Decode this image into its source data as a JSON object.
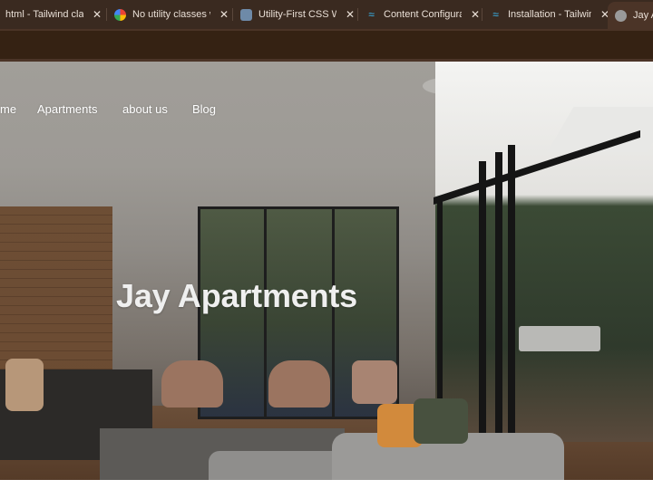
{
  "browser": {
    "tabs": [
      {
        "label": "html - Tailwind class",
        "icon": "stackoverflow-icon",
        "active": false
      },
      {
        "label": "No utility classes we",
        "icon": "google-icon",
        "active": false
      },
      {
        "label": "Utility-First CSS With",
        "icon": "cube-icon",
        "active": false
      },
      {
        "label": "Content Configuratio",
        "icon": "tailwind-icon",
        "active": false
      },
      {
        "label": "Installation - Tailwind",
        "icon": "tailwind-icon",
        "active": false
      },
      {
        "label": "Jay Ap",
        "icon": "globe-icon",
        "active": true
      }
    ],
    "close_glyph": "✕"
  },
  "page": {
    "nav": [
      {
        "label": "me"
      },
      {
        "label": "Apartments"
      },
      {
        "label": "about us"
      },
      {
        "label": "Blog"
      }
    ],
    "hero_title": "Jay Apartments"
  },
  "colors": {
    "tabbar_bg": "#3a2a20",
    "toolbar_bg": "#352213",
    "hero_text": "#efefef"
  }
}
